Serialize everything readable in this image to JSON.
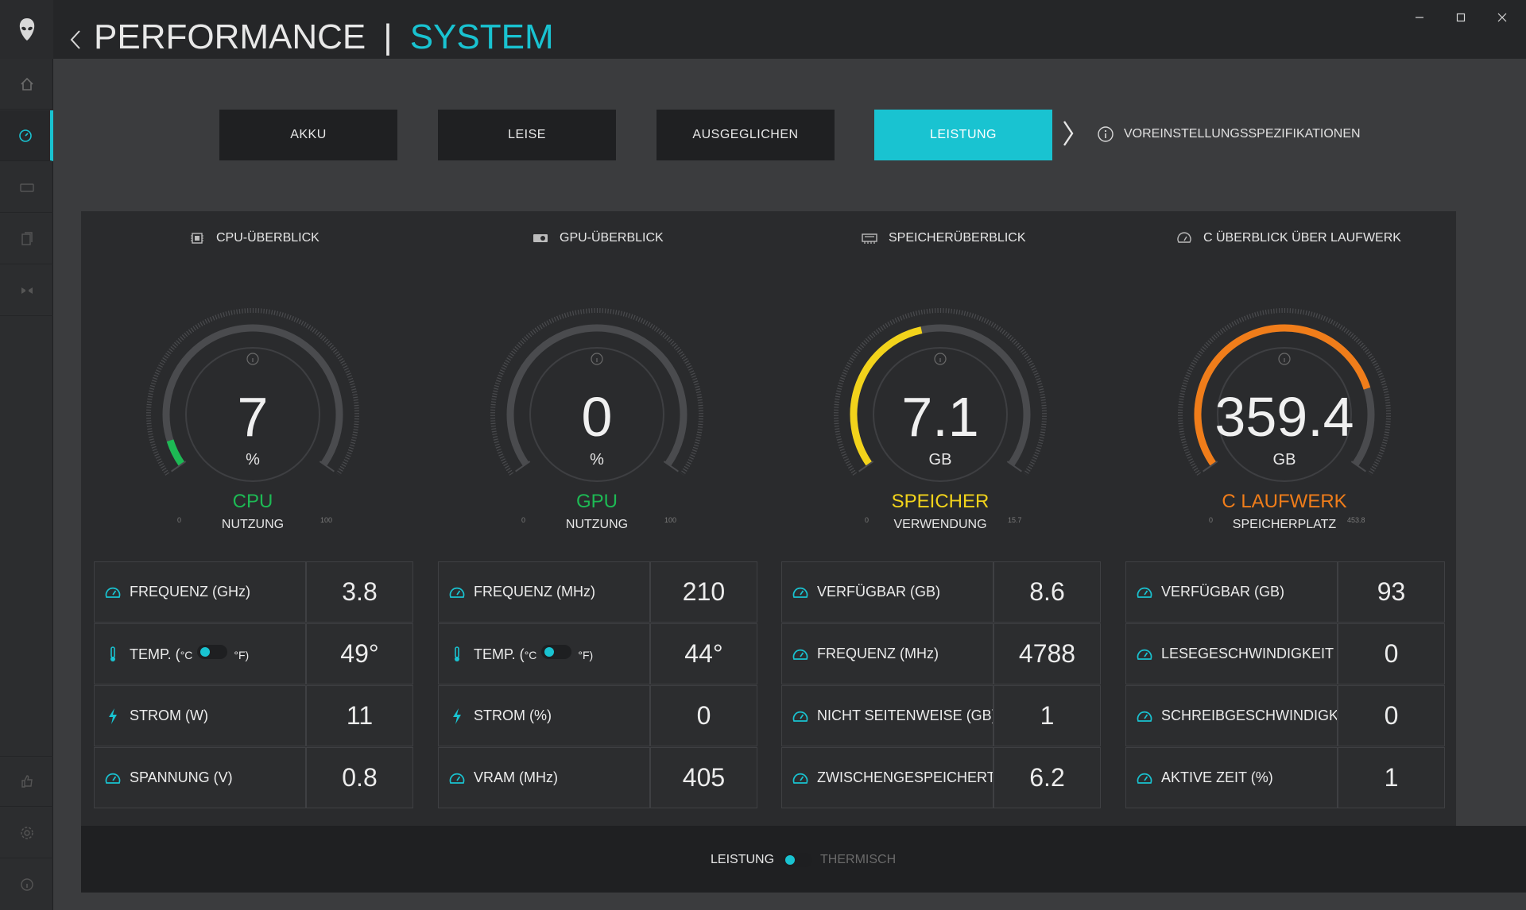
{
  "header": {
    "title_main": "PERFORMANCE",
    "separator": "|",
    "title_accent": "SYSTEM"
  },
  "presets": {
    "buttons": [
      {
        "label": "AKKU",
        "active": false
      },
      {
        "label": "LEISE",
        "active": false
      },
      {
        "label": "AUSGEGLICHEN",
        "active": false
      },
      {
        "label": "LEISTUNG",
        "active": true
      }
    ],
    "spec_link": "VOREINSTELLUNGSSPEZIFIKATIONEN"
  },
  "columns": {
    "cpu": {
      "heading": "CPU-ÜBERBLICK",
      "gauge": {
        "value": "7",
        "unit": "%",
        "name": "CPU",
        "sub": "NUTZUNG",
        "min": "0",
        "max": "100",
        "fraction": 0.07,
        "color": "#1db954"
      },
      "rows": [
        {
          "label": "FREQUENZ (GHz)",
          "value": "3.8",
          "icon": "speedometer-icon"
        },
        {
          "label_prefix": "TEMP. (",
          "unit_c": "°C",
          "unit_f": "°F)",
          "value": "49°",
          "icon": "thermometer-icon"
        },
        {
          "label": "STROM (W)",
          "value": "11",
          "icon": "lightning-icon"
        },
        {
          "label": "SPANNUNG (V)",
          "value": "0.8",
          "icon": "speedometer-icon"
        }
      ]
    },
    "gpu": {
      "heading": "GPU-ÜBERBLICK",
      "gauge": {
        "value": "0",
        "unit": "%",
        "name": "GPU",
        "sub": "NUTZUNG",
        "min": "0",
        "max": "100",
        "fraction": 0.0,
        "color": "#1db954"
      },
      "rows": [
        {
          "label": "FREQUENZ (MHz)",
          "value": "210",
          "icon": "speedometer-icon"
        },
        {
          "label_prefix": "TEMP. (",
          "unit_c": "°C",
          "unit_f": "°F)",
          "value": "44°",
          "icon": "thermometer-icon"
        },
        {
          "label": "STROM (%)",
          "value": "0",
          "icon": "lightning-icon"
        },
        {
          "label": "VRAM (MHz)",
          "value": "405",
          "icon": "speedometer-icon"
        }
      ]
    },
    "memory": {
      "heading": "SPEICHERÜBERBLICK",
      "gauge": {
        "value": "7.1",
        "unit": "GB",
        "name": "SPEICHER",
        "sub": "VERWENDUNG",
        "min": "0",
        "max": "15.7",
        "fraction": 0.45,
        "color": "#f2d31b"
      },
      "rows": [
        {
          "label": "VERFÜGBAR (GB)",
          "value": "8.6",
          "icon": "speedometer-icon"
        },
        {
          "label": "FREQUENZ (MHz)",
          "value": "4788",
          "icon": "speedometer-icon"
        },
        {
          "label": "NICHT SEITENWEISE (GB)",
          "value": "1",
          "icon": "speedometer-icon"
        },
        {
          "label": "ZWISCHENGESPEICHERT (G",
          "value": "6.2",
          "icon": "speedometer-icon"
        }
      ]
    },
    "drive": {
      "heading": "C ÜBERBLICK ÜBER LAUFWERK",
      "gauge": {
        "value": "359.4",
        "unit": "GB",
        "name": "C LAUFWERK",
        "sub": "SPEICHERPLATZ",
        "min": "0",
        "max": "453.8",
        "fraction": 0.79,
        "color": "#f07d1a"
      },
      "rows": [
        {
          "label": "VERFÜGBAR (GB)",
          "value": "93",
          "icon": "speedometer-icon"
        },
        {
          "label": "LESEGESCHWINDIGKEIT (KE",
          "value": "0",
          "icon": "speedometer-icon"
        },
        {
          "label": "SCHREIBGESCHWINDIGKEIT",
          "value": "0",
          "icon": "speedometer-icon"
        },
        {
          "label": "AKTIVE ZEIT (%)",
          "value": "1",
          "icon": "speedometer-icon"
        }
      ]
    }
  },
  "bottom": {
    "mode_on": "LEISTUNG",
    "mode_off": "THERMISCH"
  },
  "colors": {
    "accent": "#19c3d1",
    "cpu_gpu": "#1db954",
    "memory": "#f2d31b",
    "drive": "#f07d1a"
  }
}
